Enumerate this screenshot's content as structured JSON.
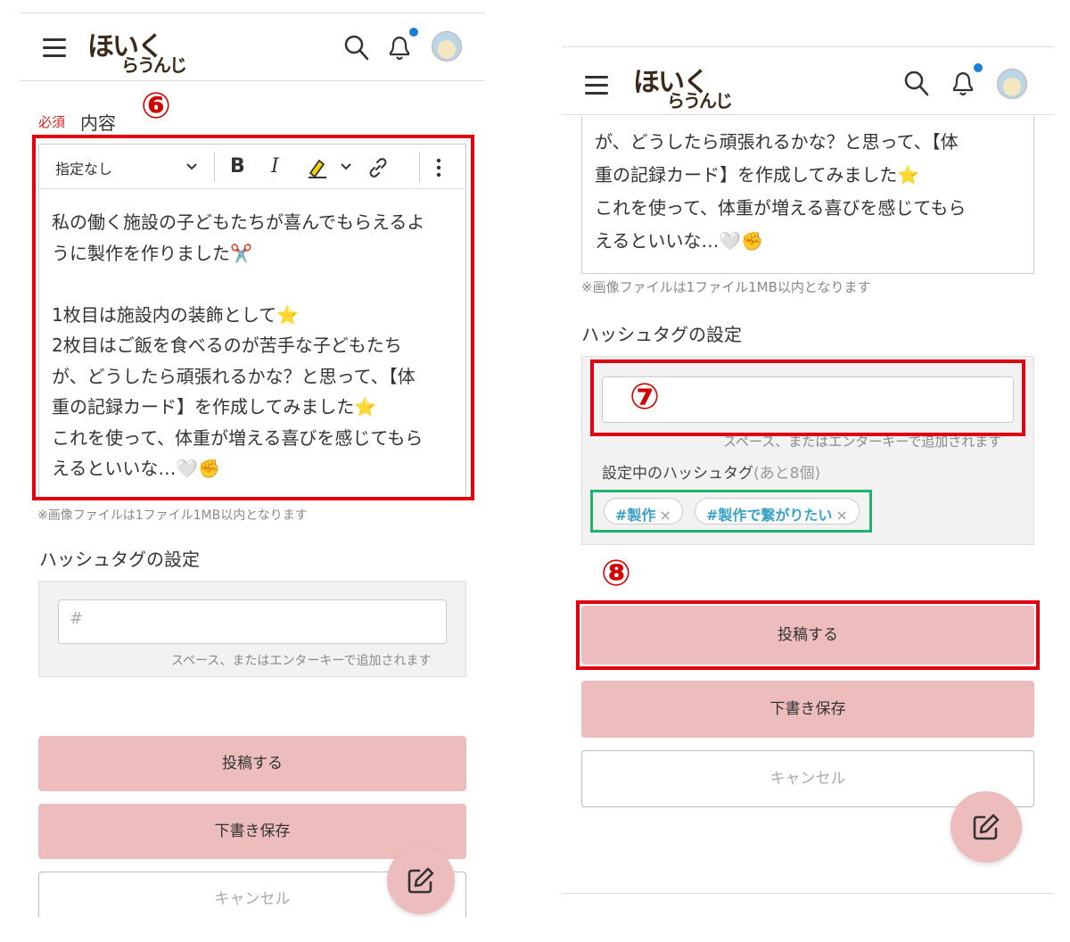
{
  "header": {
    "logo_main": "ほいく",
    "logo_sub": "らうんじ"
  },
  "annotations": {
    "six": "⑥",
    "seven": "⑦",
    "eight": "⑧"
  },
  "form": {
    "required_badge": "必須",
    "content_label": "内容",
    "toolbar": {
      "style_select": "指定なし",
      "bold": "B",
      "italic": "I"
    },
    "editor_lines_left": [
      "私の働く施設の子どもたちが喜んでもらえるよ",
      "うに製作を作りました✂️",
      "",
      "1枚目は施設内の装飾として⭐",
      "2枚目はご飯を食べるのが苦手な子どもたち",
      "が、どうしたら頑張れるかな？と思って、【体",
      "重の記録カード】を作成してみました⭐",
      "これを使って、体重が増える喜びを感じてもら",
      "えるといいな…🤍✊"
    ],
    "editor_lines_right": [
      "が、どうしたら頑張れるかな？と思って、【体",
      "重の記録カード】を作成してみました⭐",
      "これを使って、体重が増える喜びを感じてもら",
      "えるといいな…🤍✊"
    ],
    "image_note": "※画像ファイルは1ファイル1MB以内となります",
    "hashtag_heading": "ハッシュタグの設定",
    "hashtag_placeholder": "#",
    "hashtag_hint": "スペース、またはエンターキーで追加されます",
    "current_tags_label": "設定中のハッシュタグ",
    "current_tags_remaining": "(あと8個)",
    "tags": [
      "#製作",
      "#製作で繋がりたい"
    ],
    "tag_remove": "×",
    "buttons": {
      "post": "投稿する",
      "draft": "下書き保存",
      "cancel": "キャンセル"
    }
  }
}
